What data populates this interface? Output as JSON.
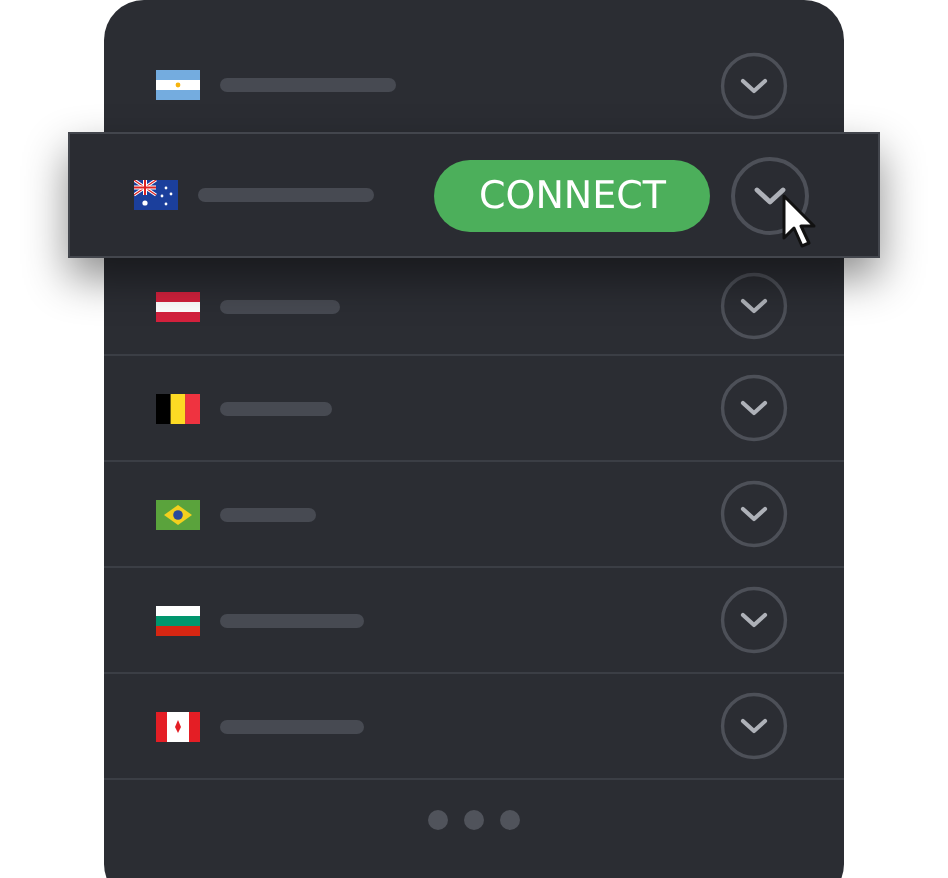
{
  "connect_label": "CONNECT",
  "servers": [
    {
      "kind": "argentina",
      "highlighted": false
    },
    {
      "kind": "australia",
      "highlighted": true
    },
    {
      "kind": "austria",
      "highlighted": false
    },
    {
      "kind": "belgium",
      "highlighted": false
    },
    {
      "kind": "brazil",
      "highlighted": false
    },
    {
      "kind": "bulgaria",
      "highlighted": false
    },
    {
      "kind": "canada",
      "highlighted": false
    }
  ],
  "pager": [
    {
      "selected": false
    },
    {
      "selected": false
    },
    {
      "selected": false
    }
  ]
}
